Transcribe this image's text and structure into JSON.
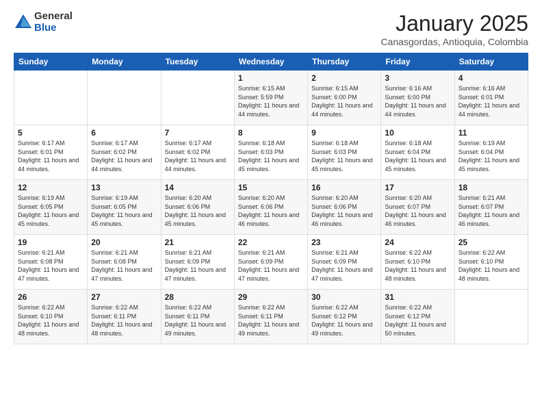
{
  "header": {
    "logo_general": "General",
    "logo_blue": "Blue",
    "month_title": "January 2025",
    "location": "Canasgordas, Antioquia, Colombia"
  },
  "weekdays": [
    "Sunday",
    "Monday",
    "Tuesday",
    "Wednesday",
    "Thursday",
    "Friday",
    "Saturday"
  ],
  "weeks": [
    [
      {
        "day": "",
        "sunrise": "",
        "sunset": "",
        "daylight": ""
      },
      {
        "day": "",
        "sunrise": "",
        "sunset": "",
        "daylight": ""
      },
      {
        "day": "",
        "sunrise": "",
        "sunset": "",
        "daylight": ""
      },
      {
        "day": "1",
        "sunrise": "Sunrise: 6:15 AM",
        "sunset": "Sunset: 5:59 PM",
        "daylight": "Daylight: 11 hours and 44 minutes."
      },
      {
        "day": "2",
        "sunrise": "Sunrise: 6:15 AM",
        "sunset": "Sunset: 6:00 PM",
        "daylight": "Daylight: 11 hours and 44 minutes."
      },
      {
        "day": "3",
        "sunrise": "Sunrise: 6:16 AM",
        "sunset": "Sunset: 6:00 PM",
        "daylight": "Daylight: 11 hours and 44 minutes."
      },
      {
        "day": "4",
        "sunrise": "Sunrise: 6:16 AM",
        "sunset": "Sunset: 6:01 PM",
        "daylight": "Daylight: 11 hours and 44 minutes."
      }
    ],
    [
      {
        "day": "5",
        "sunrise": "Sunrise: 6:17 AM",
        "sunset": "Sunset: 6:01 PM",
        "daylight": "Daylight: 11 hours and 44 minutes."
      },
      {
        "day": "6",
        "sunrise": "Sunrise: 6:17 AM",
        "sunset": "Sunset: 6:02 PM",
        "daylight": "Daylight: 11 hours and 44 minutes."
      },
      {
        "day": "7",
        "sunrise": "Sunrise: 6:17 AM",
        "sunset": "Sunset: 6:02 PM",
        "daylight": "Daylight: 11 hours and 44 minutes."
      },
      {
        "day": "8",
        "sunrise": "Sunrise: 6:18 AM",
        "sunset": "Sunset: 6:03 PM",
        "daylight": "Daylight: 11 hours and 45 minutes."
      },
      {
        "day": "9",
        "sunrise": "Sunrise: 6:18 AM",
        "sunset": "Sunset: 6:03 PM",
        "daylight": "Daylight: 11 hours and 45 minutes."
      },
      {
        "day": "10",
        "sunrise": "Sunrise: 6:18 AM",
        "sunset": "Sunset: 6:04 PM",
        "daylight": "Daylight: 11 hours and 45 minutes."
      },
      {
        "day": "11",
        "sunrise": "Sunrise: 6:19 AM",
        "sunset": "Sunset: 6:04 PM",
        "daylight": "Daylight: 11 hours and 45 minutes."
      }
    ],
    [
      {
        "day": "12",
        "sunrise": "Sunrise: 6:19 AM",
        "sunset": "Sunset: 6:05 PM",
        "daylight": "Daylight: 11 hours and 45 minutes."
      },
      {
        "day": "13",
        "sunrise": "Sunrise: 6:19 AM",
        "sunset": "Sunset: 6:05 PM",
        "daylight": "Daylight: 11 hours and 45 minutes."
      },
      {
        "day": "14",
        "sunrise": "Sunrise: 6:20 AM",
        "sunset": "Sunset: 6:06 PM",
        "daylight": "Daylight: 11 hours and 45 minutes."
      },
      {
        "day": "15",
        "sunrise": "Sunrise: 6:20 AM",
        "sunset": "Sunset: 6:06 PM",
        "daylight": "Daylight: 11 hours and 46 minutes."
      },
      {
        "day": "16",
        "sunrise": "Sunrise: 6:20 AM",
        "sunset": "Sunset: 6:06 PM",
        "daylight": "Daylight: 11 hours and 46 minutes."
      },
      {
        "day": "17",
        "sunrise": "Sunrise: 6:20 AM",
        "sunset": "Sunset: 6:07 PM",
        "daylight": "Daylight: 11 hours and 46 minutes."
      },
      {
        "day": "18",
        "sunrise": "Sunrise: 6:21 AM",
        "sunset": "Sunset: 6:07 PM",
        "daylight": "Daylight: 11 hours and 46 minutes."
      }
    ],
    [
      {
        "day": "19",
        "sunrise": "Sunrise: 6:21 AM",
        "sunset": "Sunset: 6:08 PM",
        "daylight": "Daylight: 11 hours and 47 minutes."
      },
      {
        "day": "20",
        "sunrise": "Sunrise: 6:21 AM",
        "sunset": "Sunset: 6:08 PM",
        "daylight": "Daylight: 11 hours and 47 minutes."
      },
      {
        "day": "21",
        "sunrise": "Sunrise: 6:21 AM",
        "sunset": "Sunset: 6:09 PM",
        "daylight": "Daylight: 11 hours and 47 minutes."
      },
      {
        "day": "22",
        "sunrise": "Sunrise: 6:21 AM",
        "sunset": "Sunset: 6:09 PM",
        "daylight": "Daylight: 11 hours and 47 minutes."
      },
      {
        "day": "23",
        "sunrise": "Sunrise: 6:21 AM",
        "sunset": "Sunset: 6:09 PM",
        "daylight": "Daylight: 11 hours and 47 minutes."
      },
      {
        "day": "24",
        "sunrise": "Sunrise: 6:22 AM",
        "sunset": "Sunset: 6:10 PM",
        "daylight": "Daylight: 11 hours and 48 minutes."
      },
      {
        "day": "25",
        "sunrise": "Sunrise: 6:22 AM",
        "sunset": "Sunset: 6:10 PM",
        "daylight": "Daylight: 11 hours and 48 minutes."
      }
    ],
    [
      {
        "day": "26",
        "sunrise": "Sunrise: 6:22 AM",
        "sunset": "Sunset: 6:10 PM",
        "daylight": "Daylight: 11 hours and 48 minutes."
      },
      {
        "day": "27",
        "sunrise": "Sunrise: 6:22 AM",
        "sunset": "Sunset: 6:11 PM",
        "daylight": "Daylight: 11 hours and 48 minutes."
      },
      {
        "day": "28",
        "sunrise": "Sunrise: 6:22 AM",
        "sunset": "Sunset: 6:11 PM",
        "daylight": "Daylight: 11 hours and 49 minutes."
      },
      {
        "day": "29",
        "sunrise": "Sunrise: 6:22 AM",
        "sunset": "Sunset: 6:11 PM",
        "daylight": "Daylight: 11 hours and 49 minutes."
      },
      {
        "day": "30",
        "sunrise": "Sunrise: 6:22 AM",
        "sunset": "Sunset: 6:12 PM",
        "daylight": "Daylight: 11 hours and 49 minutes."
      },
      {
        "day": "31",
        "sunrise": "Sunrise: 6:22 AM",
        "sunset": "Sunset: 6:12 PM",
        "daylight": "Daylight: 11 hours and 50 minutes."
      },
      {
        "day": "",
        "sunrise": "",
        "sunset": "",
        "daylight": ""
      }
    ]
  ]
}
